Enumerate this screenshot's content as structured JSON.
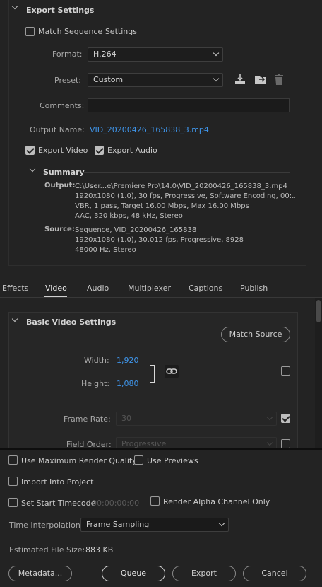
{
  "export_settings": {
    "title": "Export Settings",
    "match_sequence": "Match Sequence Settings",
    "format_label": "Format:",
    "format_value": "H.264",
    "preset_label": "Preset:",
    "preset_value": "Custom",
    "comments_label": "Comments:",
    "comments_value": "",
    "output_name_label": "Output Name:",
    "output_name_value": "VID_20200426_165838_3.mp4",
    "export_video": "Export Video",
    "export_audio": "Export Audio",
    "summary_title": "Summary",
    "output_label": "Output:",
    "output_lines": [
      "C:\\User...e\\Premiere Pro\\14.0\\VID_20200426_165838_3.mp4",
      "1920x1080 (1.0), 30 fps, Progressive, Software Encoding, 00:...",
      "VBR, 1 pass, Target 16.00 Mbps, Max 16.00 Mbps",
      "AAC, 320 kbps, 48 kHz, Stereo"
    ],
    "source_label": "Source:",
    "source_lines": [
      "Sequence, VID_20200426_165838",
      "1920x1080 (1.0), 30.012 fps, Progressive, 8928",
      "48000 Hz, Stereo"
    ]
  },
  "tabs": [
    "Effects",
    "Video",
    "Audio",
    "Multiplexer",
    "Captions",
    "Publish"
  ],
  "active_tab": "Video",
  "video": {
    "section_title": "Basic Video Settings",
    "match_source": "Match Source",
    "width_label": "Width:",
    "width_value": "1,920",
    "height_label": "Height:",
    "height_value": "1,080",
    "frame_rate_label": "Frame Rate:",
    "frame_rate_value": "30",
    "field_order_label": "Field Order:",
    "field_order_value": "Progressive"
  },
  "bottom": {
    "max_render_quality": "Use Maximum Render Quality",
    "use_previews": "Use Previews",
    "import_into_project": "Import Into Project",
    "set_start_timecode": "Set Start Timecode",
    "start_timecode_value": "00:00:00:00",
    "render_alpha": "Render Alpha Channel Only",
    "time_interp_label": "Time Interpolation:",
    "time_interp_value": "Frame Sampling",
    "est_size_label": "Estimated File Size:",
    "est_size_value": "883 KB",
    "metadata_btn": "Metadata...",
    "queue_btn": "Queue",
    "export_btn": "Export",
    "cancel_btn": "Cancel"
  },
  "colors": {
    "accent": "#3f95ea",
    "background": "#232323"
  }
}
